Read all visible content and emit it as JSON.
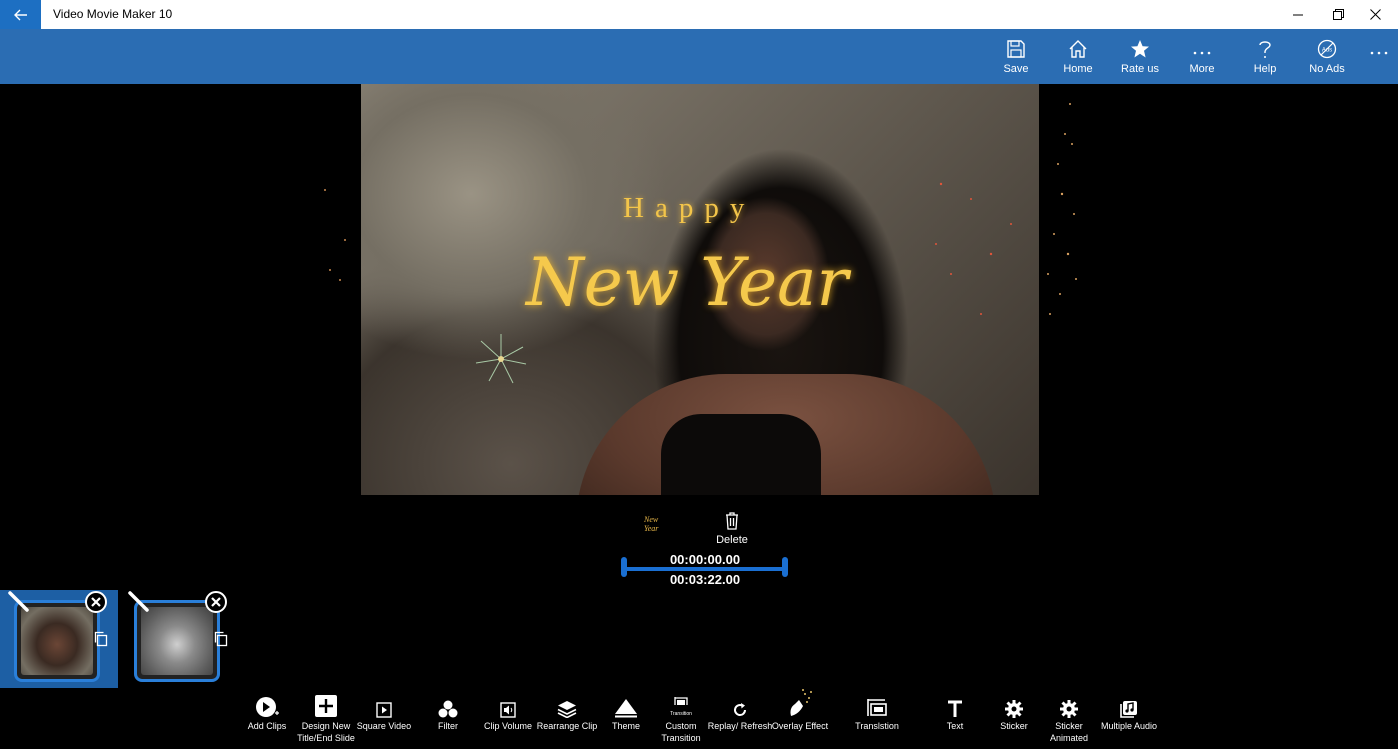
{
  "app": {
    "title": "Video Movie Maker 10"
  },
  "commandbar": {
    "items": [
      {
        "label": "Save",
        "icon": "save-icon"
      },
      {
        "label": "Home",
        "icon": "home-icon"
      },
      {
        "label": "Rate us",
        "icon": "star-icon"
      },
      {
        "label": "More",
        "icon": "ellipsis-icon"
      },
      {
        "label": "Help",
        "icon": "question-icon"
      },
      {
        "label": "No Ads",
        "icon": "no-ads-icon"
      }
    ]
  },
  "preview": {
    "title_line1": "Happy",
    "title_line2": "New Year"
  },
  "clip_controls": {
    "delete_label": "Delete",
    "start_time": "00:00:00.00",
    "end_time": "00:03:22.00",
    "mini_thumb_text": "New Year"
  },
  "clips": [
    {
      "name": "clip-1",
      "selected": true
    },
    {
      "name": "clip-2",
      "selected": false
    }
  ],
  "toolbar": {
    "items": [
      {
        "label": "Add Clips",
        "icon": "add-clips-icon"
      },
      {
        "label": "Design New Title/End Slide",
        "icon": "design-title-icon"
      },
      {
        "label": "Square Video",
        "icon": "square-video-icon"
      },
      {
        "label": "Filter",
        "icon": "filter-icon"
      },
      {
        "label": "Clip Volume",
        "icon": "clip-volume-icon"
      },
      {
        "label": "Rearrange Clip",
        "icon": "rearrange-icon"
      },
      {
        "label": "Theme",
        "icon": "theme-icon"
      },
      {
        "label": "Custom Transition",
        "icon": "custom-transition-icon"
      },
      {
        "label": "Replay/ Refresh",
        "icon": "refresh-icon"
      },
      {
        "label": "Overlay Effect",
        "icon": "overlay-effect-icon"
      },
      {
        "label": "Translstion",
        "icon": "transition-icon"
      },
      {
        "label": "Text",
        "icon": "text-icon"
      },
      {
        "label": "Sticker",
        "icon": "sticker-icon"
      },
      {
        "label": "Sticker Animated",
        "icon": "sticker-animated-icon"
      },
      {
        "label": "Multiple Audio",
        "icon": "multiple-audio-icon"
      }
    ]
  },
  "colors": {
    "accent": "#2b6db3",
    "back_button": "#1d6fc2",
    "timeline": "#1a6fd2",
    "title_gold": "#f3c54a"
  }
}
